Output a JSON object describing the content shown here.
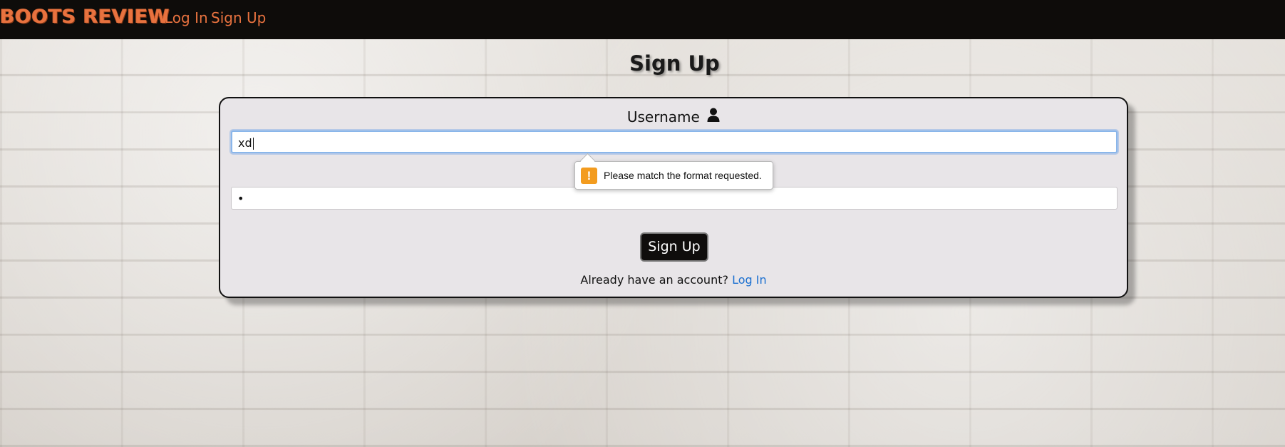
{
  "navbar": {
    "brand": "BOOTS REVIEW",
    "links": [
      "Log In",
      "Sign Up"
    ]
  },
  "page": {
    "title": "Sign Up"
  },
  "form": {
    "username_label": "Username",
    "username_value": "xd",
    "password_value": "•",
    "validation_message": "Please match the format requested.",
    "submit_label": "Sign Up",
    "login_prompt": "Already have an account?",
    "login_link": "Log In"
  },
  "icons": {
    "username": "user-icon",
    "validation": "warning-icon"
  },
  "colors": {
    "navbar_bg": "#0e0c0a",
    "brand": "#e8723f",
    "link": "#1a6fd0",
    "warning": "#f39c1f",
    "focus_border": "#8ab6ea"
  }
}
